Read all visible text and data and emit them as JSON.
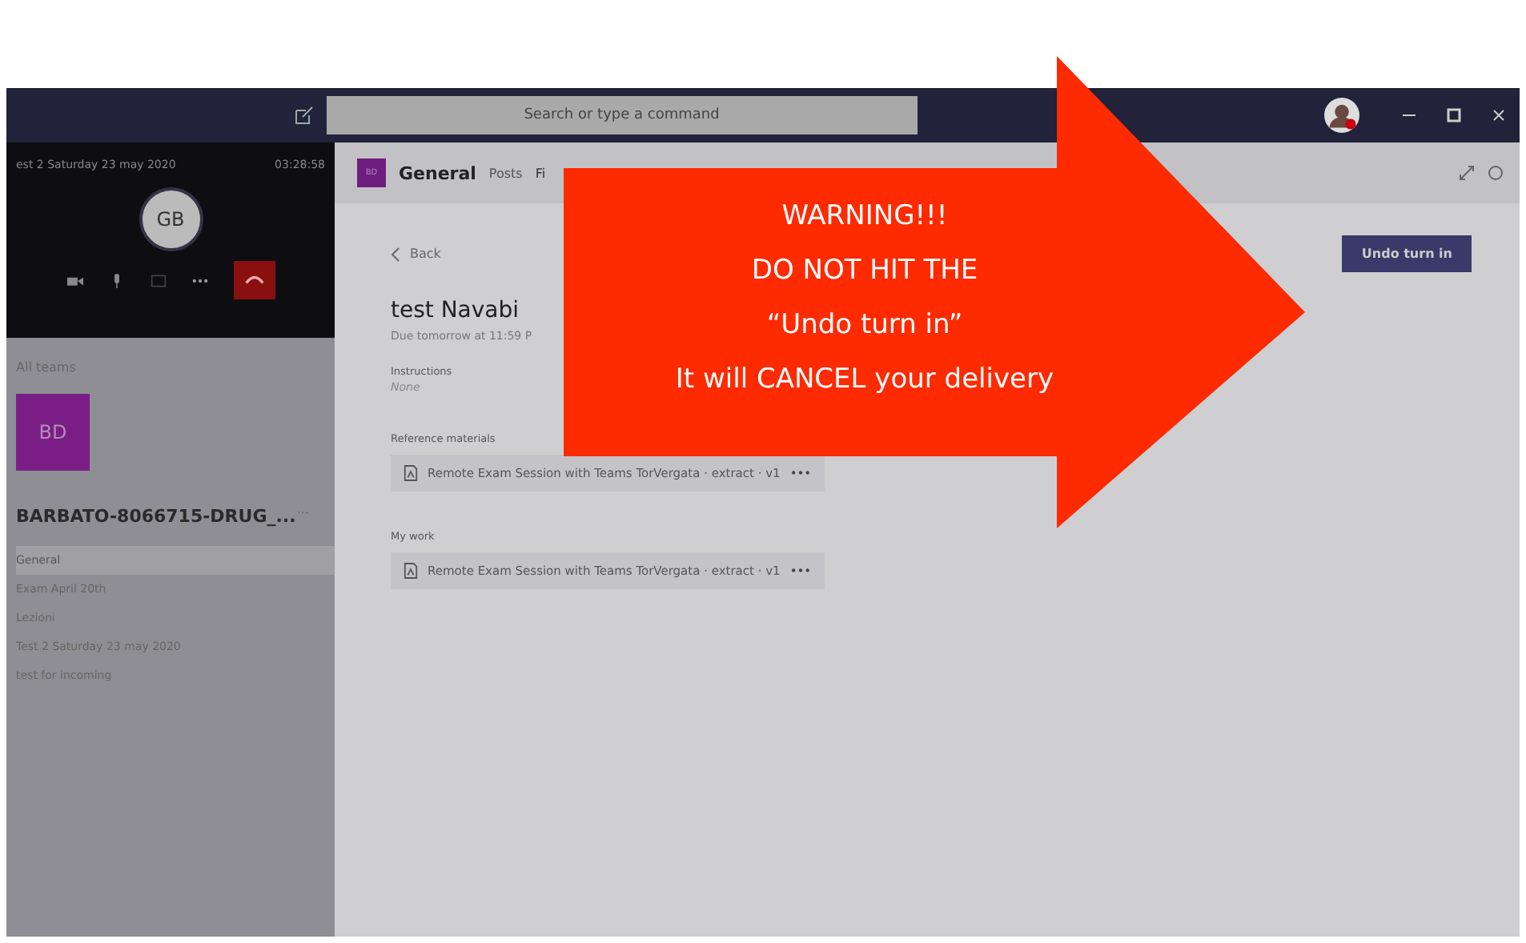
{
  "title_bar": {
    "search": {
      "placeholder": "Search or type a command"
    }
  },
  "call": {
    "title": "est 2 Saturday 23 may 2020",
    "timer": "03:28:58",
    "avatar": "GB"
  },
  "sidebar": {
    "back": "All teams",
    "team_initials": "BD",
    "team_name": "BARBATO-8066715-DRUG_...",
    "more": "···",
    "channels": [
      {
        "label": "General",
        "selected": true
      },
      {
        "label": "Exam April 20th",
        "selected": false
      },
      {
        "label": "Lezioni",
        "selected": false
      },
      {
        "label": "Test 2 Saturday 23 may 2020",
        "selected": false
      },
      {
        "label": "test for incoming",
        "selected": false
      }
    ]
  },
  "channel_header": {
    "initials": "BD",
    "name": "General",
    "tabs": [
      {
        "label": "Posts",
        "selected": false
      },
      {
        "label": "Fi",
        "selected": true
      }
    ]
  },
  "assignment": {
    "back": "Back",
    "title": "test Navabi",
    "due": "Due tomorrow at 11:59 P",
    "instructions_label": "Instructions",
    "instructions": "None",
    "sections": [
      {
        "label": "Reference materials",
        "file": "Remote Exam Session with Teams TorVergata · extract · v1",
        "more": "•••"
      },
      {
        "label": "My work",
        "file": "Remote Exam Session with Teams TorVergata · extract · v1",
        "more": "•••"
      }
    ],
    "action": "Undo turn in"
  },
  "warning": {
    "lines": [
      "WARNING!!!",
      "DO NOT HIT THE",
      "“Undo turn in”",
      "It will CANCEL your delivery"
    ]
  }
}
